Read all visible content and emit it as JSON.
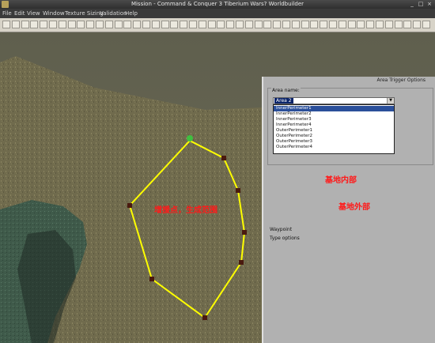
{
  "window": {
    "title": "Mission - Command & Conquer 3 Tiberium Wars? Worldbuilder",
    "controls": [
      "_",
      "□",
      "×"
    ]
  },
  "menu": [
    "File",
    "Edit",
    "View",
    "Window",
    "Texture Sizing",
    "Validation",
    "Help"
  ],
  "panel": {
    "title": "Area Trigger Options",
    "group_label": "Area name:",
    "selected_area": "Area 2",
    "options": [
      {
        "label": "InnerPerimeter1",
        "selected": true
      },
      {
        "label": "InnerPerimeter2",
        "selected": false
      },
      {
        "label": "InnerPerimeter3",
        "selected": false
      },
      {
        "label": "InnerPerimeter4",
        "selected": false
      },
      {
        "label": "OuterPerimeter1",
        "selected": false
      },
      {
        "label": "OuterPerimeter2",
        "selected": false
      },
      {
        "label": "OuterPerimeter3",
        "selected": false
      },
      {
        "label": "OuterPerimeter4",
        "selected": false
      }
    ],
    "waypoint_label": "Waypoint",
    "type_options_label": "Type options"
  },
  "annotations": {
    "spawn": "增援点，生成范围",
    "base_inner": "基地内部",
    "base_outer": "基地外部"
  },
  "colors": {
    "grass": "#6f6b4f",
    "trigger_area_line": "#ffff00",
    "annotation": "#ff1a1a",
    "selection": "#0a246a"
  }
}
